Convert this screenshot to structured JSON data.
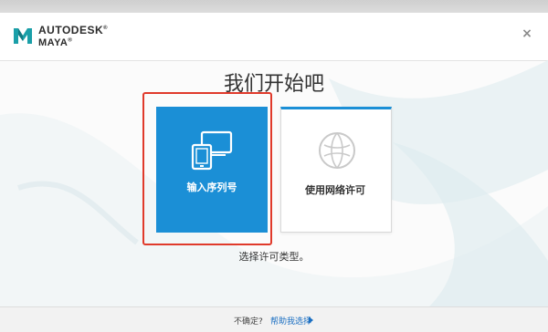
{
  "header": {
    "brand_line1": "AUTODESK",
    "brand_line1_mark": "®",
    "brand_line2": "MAYA",
    "brand_line2_mark": "®",
    "close_label": "×",
    "logo_icon": "maya-logo-icon"
  },
  "main": {
    "title": "我们开始吧",
    "subtitle": "选择许可类型。"
  },
  "cards": {
    "serial": {
      "label": "输入序列号",
      "icon": "devices-icon",
      "selected": true
    },
    "network": {
      "label": "使用网络许可",
      "icon": "globe-icon"
    }
  },
  "footer": {
    "question": "不确定?",
    "help_link": "帮助我选择",
    "arrow_icon": "play-arrow-icon"
  },
  "colors": {
    "accent": "#1b8fd6",
    "selection": "#e03a2b",
    "link": "#1b6fc2"
  }
}
